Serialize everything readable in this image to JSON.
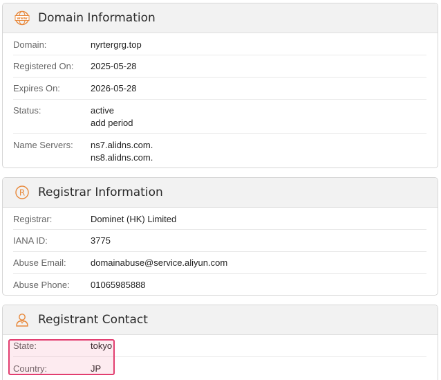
{
  "domain_info": {
    "title": "Domain Information",
    "icon": "www-icon",
    "rows": [
      {
        "label": "Domain:",
        "values": [
          "nyrtergrg.top"
        ]
      },
      {
        "label": "Registered On:",
        "values": [
          "2025-05-28"
        ]
      },
      {
        "label": "Expires On:",
        "values": [
          "2026-05-28"
        ]
      },
      {
        "label": "Status:",
        "values": [
          "active",
          "add period"
        ]
      },
      {
        "label": "Name Servers:",
        "values": [
          "ns7.alidns.com.",
          "ns8.alidns.com."
        ]
      }
    ]
  },
  "registrar_info": {
    "title": "Registrar Information",
    "icon": "registered-icon",
    "rows": [
      {
        "label": "Registrar:",
        "values": [
          "Dominet (HK) Limited"
        ]
      },
      {
        "label": "IANA ID:",
        "values": [
          "3775"
        ]
      },
      {
        "label": "Abuse Email:",
        "values": [
          "domainabuse@service.aliyun.com"
        ]
      },
      {
        "label": "Abuse Phone:",
        "values": [
          "01065985888"
        ]
      }
    ]
  },
  "registrant_contact": {
    "title": "Registrant Contact",
    "icon": "person-icon",
    "rows": [
      {
        "label": "State:",
        "values": [
          "tokyo"
        ]
      },
      {
        "label": "Country:",
        "values": [
          "JP"
        ]
      }
    ]
  },
  "colors": {
    "accent": "#e8883a",
    "highlight": "#e23d6f"
  }
}
